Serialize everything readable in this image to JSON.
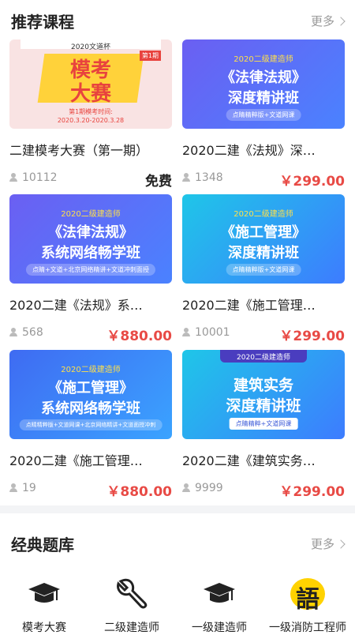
{
  "recommended": {
    "title": "推荐课程",
    "more": "更多",
    "courses": [
      {
        "title": "二建模考大赛（第一期）",
        "students": "10112",
        "price": "免费",
        "thumb": {
          "top": "2020文道杯",
          "mid1": "模考",
          "mid2": "大赛",
          "badge": "第1期",
          "sub1": "第1期模考时间:",
          "sub2": "2020.3.20-2020.3.28"
        }
      },
      {
        "title": "2020二建《法规》深…",
        "students": "1348",
        "price": "￥299.00",
        "thumb": {
          "top": "2020二级建造师",
          "mid1": "《法律法规》",
          "mid2": "深度精讲班",
          "bot": "点睛精粹版+文道网课"
        }
      },
      {
        "title": "2020二建《法规》系…",
        "students": "568",
        "price": "￥880.00",
        "thumb": {
          "top": "2020二级建造师",
          "mid1": "《法律法规》",
          "mid2": "系统网络畅学班",
          "bot": "点睛+文道+北京网络精讲+文道冲刺面授"
        }
      },
      {
        "title": "2020二建《施工管理…",
        "students": "10001",
        "price": "￥299.00",
        "thumb": {
          "top": "2020二级建造师",
          "mid1": "《施工管理》",
          "mid2": "深度精讲班",
          "bot": "点睛精粹版+文道网课"
        }
      },
      {
        "title": "2020二建《施工管理…",
        "students": "19",
        "price": "￥880.00",
        "thumb": {
          "top": "2020二级建造师",
          "mid1": "《施工管理》",
          "mid2": "系统网络畅学班",
          "bot": "点睛精粹版+文道网课+北京网络精讲+文道面授冲刺"
        }
      },
      {
        "title": "2020二建《建筑实务…",
        "students": "9999",
        "price": "￥299.00",
        "thumb": {
          "top": "2020二级建造师",
          "mid1": "建筑实务",
          "mid2": "深度精讲班",
          "bot": "点睛精粹+文道网课"
        }
      }
    ]
  },
  "question_bank": {
    "title": "经典题库",
    "more": "更多",
    "items": [
      {
        "label": "模考大赛",
        "icon": "graduation-cap-icon"
      },
      {
        "label": "二级建造师",
        "icon": "wrench-icon"
      },
      {
        "label": "一级建造师",
        "icon": "graduation-cap-icon"
      },
      {
        "label": "一级消防工程师",
        "icon": "language-icon",
        "glyph": "語"
      }
    ]
  },
  "colors": {
    "price": "#e84a45",
    "accent_yellow": "#ffe04a",
    "blue": "#3f6bf2"
  }
}
